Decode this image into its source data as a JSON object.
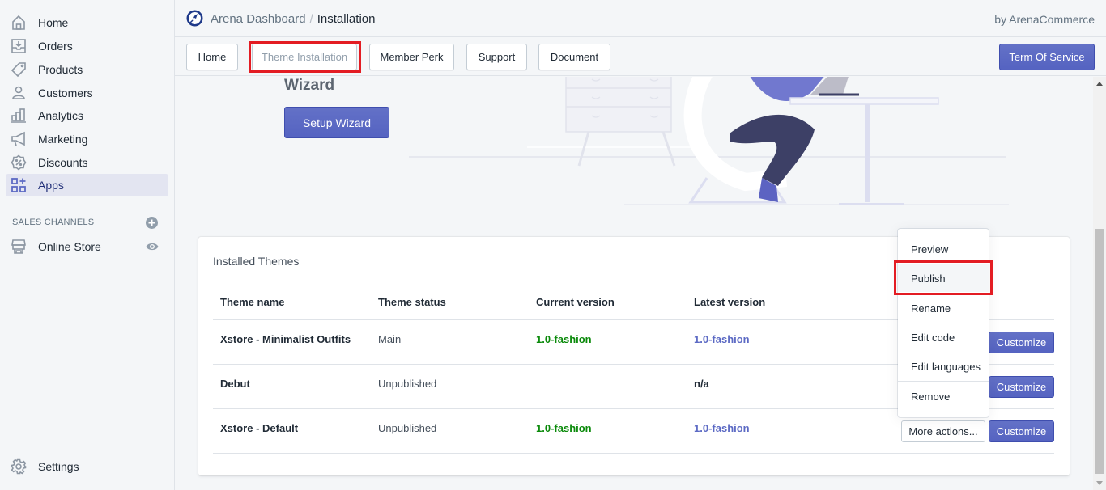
{
  "sidebar": {
    "items": [
      {
        "label": "Home",
        "icon": "home-icon"
      },
      {
        "label": "Orders",
        "icon": "orders-icon"
      },
      {
        "label": "Products",
        "icon": "tag-icon"
      },
      {
        "label": "Customers",
        "icon": "person-icon"
      },
      {
        "label": "Analytics",
        "icon": "bar-chart-icon"
      },
      {
        "label": "Marketing",
        "icon": "megaphone-icon"
      },
      {
        "label": "Discounts",
        "icon": "discount-icon"
      },
      {
        "label": "Apps",
        "icon": "apps-icon",
        "active": true
      }
    ],
    "sales_channels_title": "SALES CHANNELS",
    "channels": [
      {
        "label": "Online Store",
        "icon": "store-icon"
      }
    ],
    "settings_label": "Settings"
  },
  "header": {
    "app_name": "Arena Dashboard",
    "separator": "/",
    "page": "Installation",
    "by_line": "by ArenaCommerce"
  },
  "tabs": [
    {
      "label": "Home"
    },
    {
      "label": "Theme Installation",
      "active": true,
      "highlighted": true
    },
    {
      "label": "Member Perk"
    },
    {
      "label": "Support"
    },
    {
      "label": "Document"
    }
  ],
  "term_button": "Term Of Service",
  "wizard": {
    "title": "Wizard",
    "button": "Setup Wizard"
  },
  "themes": {
    "title": "Installed Themes",
    "columns": [
      "Theme name",
      "Theme status",
      "Current version",
      "Latest version"
    ],
    "rows": [
      {
        "name": "Xstore - Minimalist Outfits",
        "status": "Main",
        "current": "1.0-fashion",
        "latest": "1.0-fashion",
        "action": "Customize"
      },
      {
        "name": "Debut",
        "status": "Unpublished",
        "current": "",
        "latest": "n/a",
        "action": "Customize"
      },
      {
        "name": "Xstore - Default",
        "status": "Unpublished",
        "current": "1.0-fashion",
        "latest": "1.0-fashion",
        "action": "Customize",
        "more_actions": "More actions..."
      }
    ]
  },
  "dropdown": {
    "items": [
      "Preview",
      "Publish",
      "Rename",
      "Edit code",
      "Edit languages",
      "Remove"
    ],
    "highlighted": "Publish"
  },
  "colors": {
    "accent": "#5c6ac4",
    "current_version": "#0b8a0b",
    "highlight_box": "#e31c23"
  }
}
